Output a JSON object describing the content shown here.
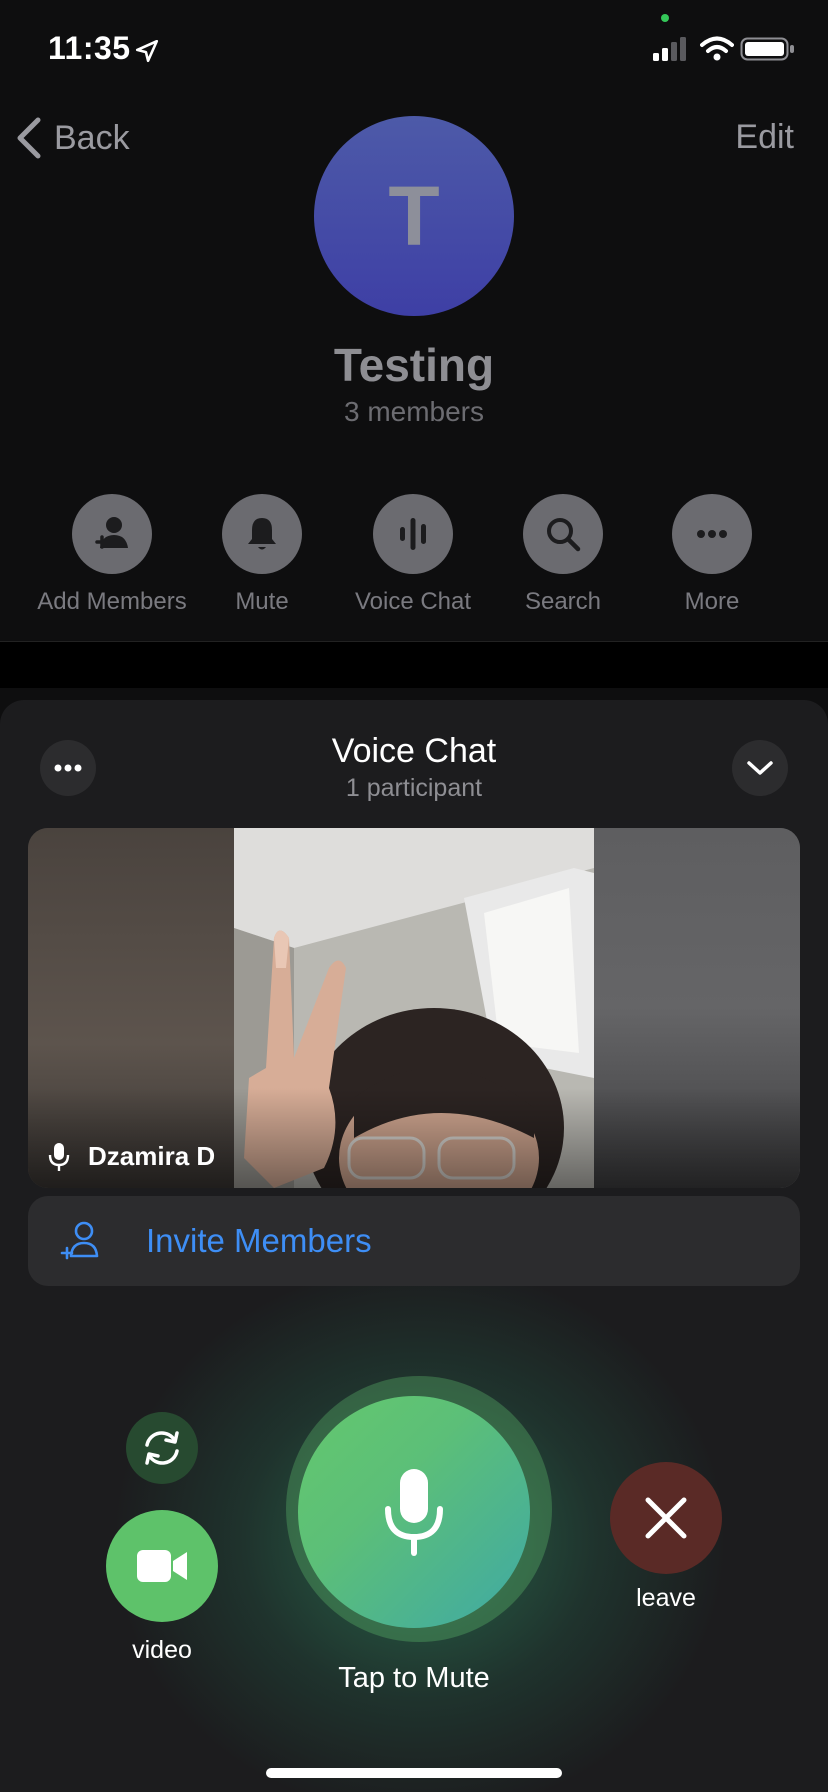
{
  "status_bar": {
    "time": "11:35"
  },
  "header": {
    "back_label": "Back",
    "edit_label": "Edit",
    "avatar_letter": "T",
    "group_name": "Testing",
    "member_count": "3 members"
  },
  "actions": [
    {
      "label": "Add Members",
      "icon": "add-member-icon"
    },
    {
      "label": "Mute",
      "icon": "bell-icon"
    },
    {
      "label": "Voice Chat",
      "icon": "voice-bars-icon"
    },
    {
      "label": "Search",
      "icon": "search-icon"
    },
    {
      "label": "More",
      "icon": "ellipsis-icon"
    }
  ],
  "voice_chat": {
    "title": "Voice Chat",
    "subtitle": "1 participant",
    "participant_name": "Dzamira D",
    "invite_label": "Invite Members",
    "video_label": "video",
    "mic_label": "Tap to Mute",
    "leave_label": "leave"
  },
  "colors": {
    "accent_blue": "#3e8ef5",
    "mic_green": "#64c86e",
    "leave_red": "#5a2a26"
  }
}
